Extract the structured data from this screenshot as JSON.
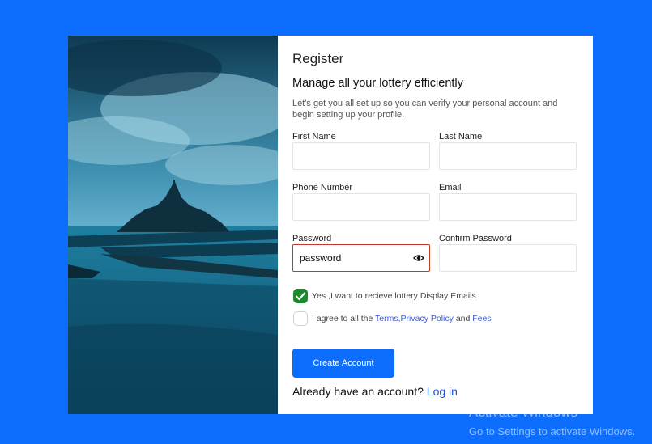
{
  "page": {
    "title": "Register",
    "subtitle": "Manage all your lottery efficiently",
    "description": "Let's get you all set up so you can verify your personal account and begin setting up your profile."
  },
  "fields": {
    "first_name": {
      "label": "First Name",
      "value": ""
    },
    "last_name": {
      "label": "Last Name",
      "value": ""
    },
    "phone": {
      "label": "Phone Number",
      "value": ""
    },
    "email": {
      "label": "Email",
      "value": ""
    },
    "password": {
      "label": "Password",
      "value": "password"
    },
    "confirm_password": {
      "label": "Confirm Password",
      "value": ""
    }
  },
  "checkboxes": {
    "emails": {
      "text": "Yes ,I want to recieve lottery Display Emails",
      "checked": true
    },
    "terms": {
      "prefix": "I agree to all the ",
      "terms_link": "Terms",
      "sep": ",",
      "privacy_link": "Privacy Policy",
      "and": " and ",
      "fees_link": "Fees",
      "checked": false
    }
  },
  "actions": {
    "create_account": "Create Account",
    "already": "Already have an account?",
    "login_link": "Log in"
  },
  "watermark": {
    "line1": "Activate Windows",
    "line2": "Go to Settings to activate Windows."
  },
  "colors": {
    "background": "#0d6efd",
    "primary_button": "#0d6efd",
    "checkbox_checked": "#1a8a2b",
    "active_field_border": "#c0392b"
  },
  "icons": [
    "eye-icon",
    "checkmark-icon"
  ]
}
